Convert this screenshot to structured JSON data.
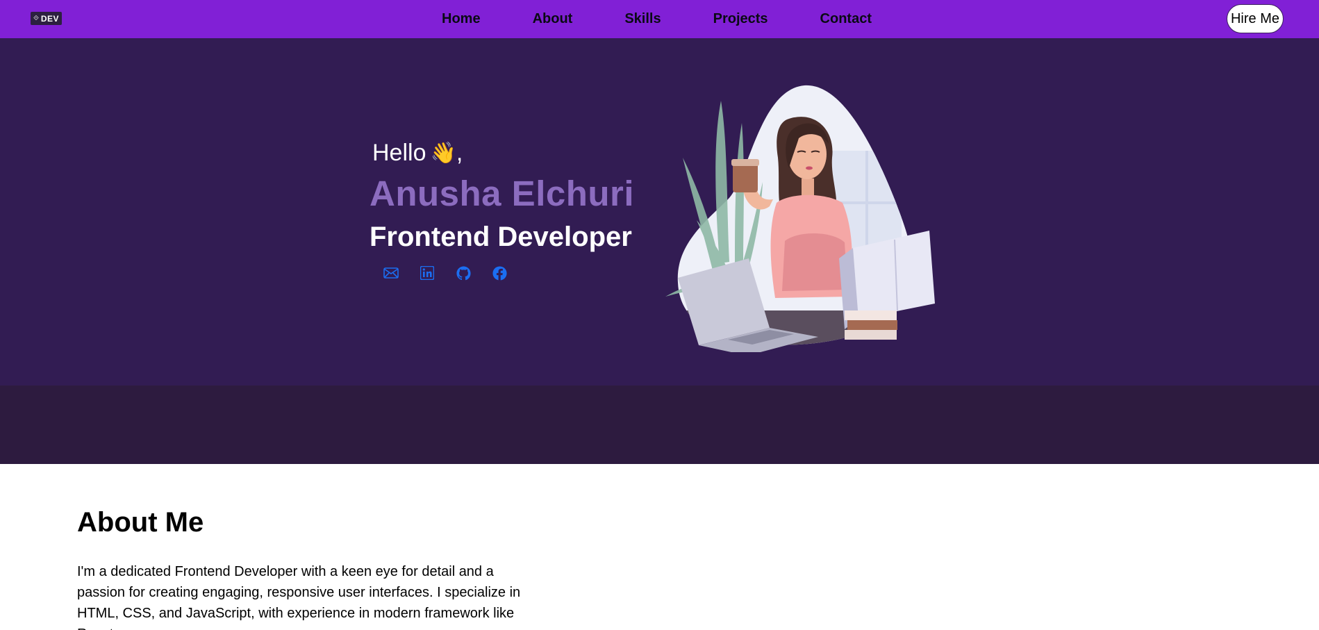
{
  "brand": {
    "logo_icon": "⟐",
    "logo_text": "DEV"
  },
  "nav": {
    "links": [
      "Home",
      "About",
      "Skills",
      "Projects",
      "Contact"
    ],
    "hire_label": "Hire Me"
  },
  "hero": {
    "greeting": "Hello",
    "greeting_suffix": ",",
    "wave_emoji": "👋",
    "name": "Anusha Elchuri",
    "role": "Frontend Developer",
    "socials": [
      "email-icon",
      "linkedin-icon",
      "github-icon",
      "facebook-icon"
    ]
  },
  "about": {
    "title": "About Me",
    "text": "I'm a dedicated Frontend Developer with a keen eye for detail and a passion for creating engaging, responsive user interfaces. I specialize in HTML, CSS, and JavaScript, with experience in modern framework like React."
  },
  "colors": {
    "nav_bg": "#8120d6",
    "hero_bg": "#321c53",
    "band_bg": "#2d1b3f",
    "name_color": "#8c6cbf",
    "social_icon": "#1b6ef2"
  }
}
